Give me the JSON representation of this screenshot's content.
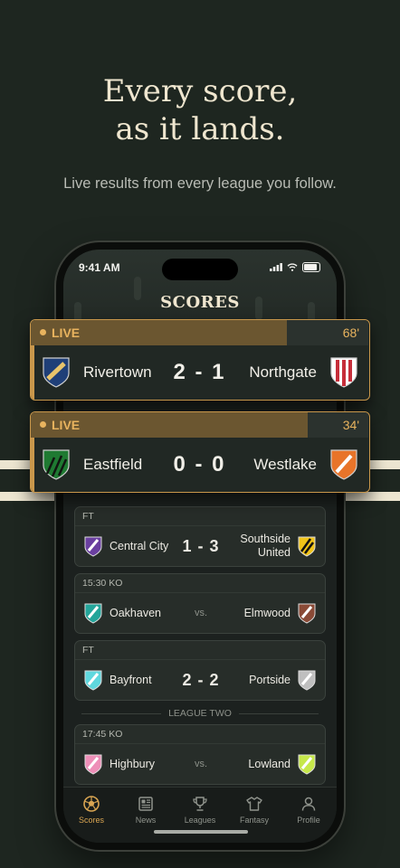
{
  "promo": {
    "headline_line1": "Every score,",
    "headline_line2": "as it lands.",
    "subhead": "Live results from every league you follow."
  },
  "status_bar": {
    "time": "9:41 AM"
  },
  "screen_title": "SCORES",
  "live_matches": [
    {
      "status": "LIVE",
      "minute": "68'",
      "progress": 0.76,
      "home": "Rivertown",
      "score": "2 - 1",
      "away": "Northgate",
      "home_crest": {
        "icon": "crest-hoop-icon",
        "color": "#1f3f78",
        "accent": "#e8c46b"
      },
      "away_crest": {
        "icon": "crest-stripes-icon",
        "color": "#c62e3a",
        "accent": "#ffffff"
      }
    },
    {
      "status": "LIVE",
      "minute": "34'",
      "progress": 0.82,
      "home": "Eastfield",
      "score": "0 - 0",
      "away": "Westlake",
      "home_crest": {
        "icon": "crest-chevron-icon",
        "color": "#1f7a32",
        "accent": "#111611"
      },
      "away_crest": {
        "icon": "crest-sash-icon",
        "color": "#e8742a",
        "accent": "#ffffff"
      }
    }
  ],
  "matches": [
    {
      "status": "FT",
      "home": "Central City",
      "score": "1 - 3",
      "away_line1": "Southside",
      "away_line2": "United",
      "home_crest": {
        "icon": "crest-sash-icon",
        "color": "#6a3fa0",
        "accent": "#ffffff"
      },
      "away_crest": {
        "icon": "crest-stripes-icon",
        "color": "#f0c419",
        "accent": "#111111"
      }
    },
    {
      "status": "15:30 KO",
      "home": "Oakhaven",
      "score": "vs.",
      "away": "Elmwood",
      "home_crest": {
        "icon": "crest-sash-icon",
        "color": "#23a59a",
        "accent": "#ffffff"
      },
      "away_crest": {
        "icon": "crest-sash-icon",
        "color": "#8a4a36",
        "accent": "#ffffff"
      }
    },
    {
      "status": "FT",
      "home": "Bayfront",
      "score": "2 - 2",
      "away": "Portside",
      "home_crest": {
        "icon": "crest-sash-icon",
        "color": "#5fd8de",
        "accent": "#ffffff"
      },
      "away_crest": {
        "icon": "crest-sash-icon",
        "color": "#bfbfbf",
        "accent": "#ffffff"
      }
    }
  ],
  "league_divider": "LEAGUE TWO",
  "league_two_matches": [
    {
      "status": "17:45 KO",
      "home": "Highbury",
      "score": "vs.",
      "away": "Lowland",
      "home_crest": {
        "icon": "crest-sash-icon",
        "color": "#ee8fb8",
        "accent": "#ffffff"
      },
      "away_crest": {
        "icon": "crest-sash-icon",
        "color": "#c6e84a",
        "accent": "#ffffff"
      }
    }
  ],
  "tabs": [
    {
      "label": "Scores",
      "icon": "ball-icon",
      "active": true
    },
    {
      "label": "News",
      "icon": "newspaper-icon",
      "active": false
    },
    {
      "label": "Leagues",
      "icon": "trophy-icon",
      "active": false
    },
    {
      "label": "Fantasy",
      "icon": "shirt-icon",
      "active": false
    },
    {
      "label": "Profile",
      "icon": "person-icon",
      "active": false
    }
  ],
  "colors": {
    "accent": "#c9974b",
    "live": "#e8b35e",
    "background": "#1e2620"
  }
}
